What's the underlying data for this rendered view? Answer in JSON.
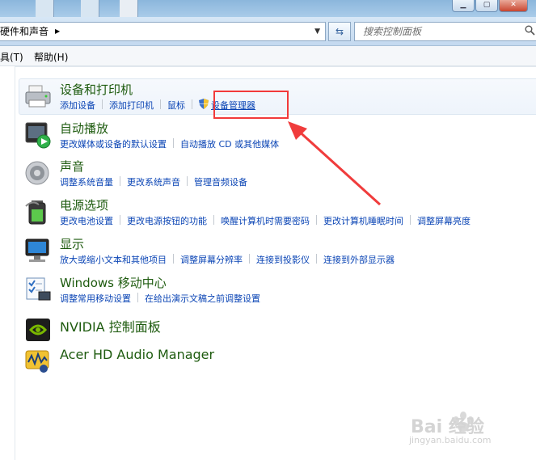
{
  "address": {
    "path": "硬件和声音",
    "separator": "▶",
    "dropdown": "▼"
  },
  "search": {
    "placeholder": "搜索控制面板"
  },
  "menu": {
    "tools": "具(T)",
    "help": "帮助(H)"
  },
  "categories": [
    {
      "title": "设备和打印机",
      "links": [
        "添加设备",
        "添加打印机",
        "鼠标",
        "设备管理器"
      ],
      "icon": "printer-icon"
    },
    {
      "title": "自动播放",
      "links": [
        "更改媒体或设备的默认设置",
        "自动播放 CD 或其他媒体"
      ],
      "icon": "autoplay-icon"
    },
    {
      "title": "声音",
      "links": [
        "调整系统音量",
        "更改系统声音",
        "管理音频设备"
      ],
      "icon": "speaker-icon"
    },
    {
      "title": "电源选项",
      "links": [
        "更改电池设置",
        "更改电源按钮的功能",
        "唤醒计算机时需要密码",
        "更改计算机睡眠时间",
        "调整屏幕亮度"
      ],
      "icon": "battery-icon"
    },
    {
      "title": "显示",
      "links": [
        "放大或缩小文本和其他项目",
        "调整屏幕分辨率",
        "连接到投影仪",
        "连接到外部显示器"
      ],
      "icon": "display-icon"
    },
    {
      "title": "Windows 移动中心",
      "links": [
        "调整常用移动设置",
        "在给出演示文稿之前调整设置"
      ],
      "icon": "mobility-center-icon"
    },
    {
      "title": "NVIDIA 控制面板",
      "links": [],
      "icon": "nvidia-icon"
    },
    {
      "title": "Acer HD Audio Manager",
      "links": [],
      "icon": "audio-manager-icon"
    }
  ],
  "watermark": {
    "brand": "Bai 经验",
    "url": "jingyan.baidu.com"
  }
}
